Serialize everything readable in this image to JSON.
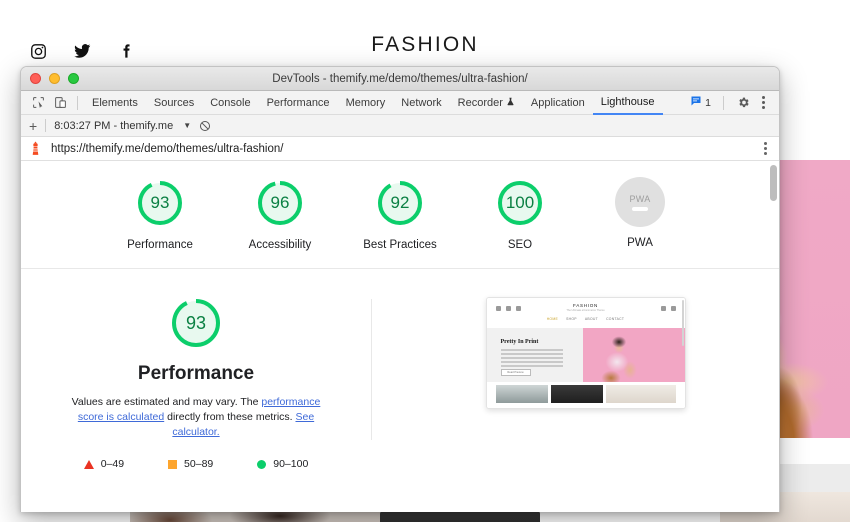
{
  "background_site": {
    "brand": "FASHION",
    "social_icons": [
      "instagram-icon",
      "twitter-icon",
      "facebook-icon"
    ]
  },
  "window": {
    "title": "DevTools - themify.me/demo/themes/ultra-fashion/",
    "traffic_lights": [
      "close",
      "minimize",
      "zoom"
    ]
  },
  "devtools": {
    "left_icons": [
      "inspect-element-icon",
      "device-toolbar-icon"
    ],
    "tabs": [
      {
        "label": "Elements",
        "active": false
      },
      {
        "label": "Sources",
        "active": false
      },
      {
        "label": "Console",
        "active": false
      },
      {
        "label": "Performance",
        "active": false
      },
      {
        "label": "Memory",
        "active": false
      },
      {
        "label": "Network",
        "active": false
      },
      {
        "label": "Recorder",
        "active": false,
        "icon": "experiment-flask-icon"
      },
      {
        "label": "Application",
        "active": false
      },
      {
        "label": "Lighthouse",
        "active": true
      }
    ],
    "message_count": "1",
    "right_icons": [
      "messages-icon",
      "settings-gear-icon",
      "more-options-kebab-icon"
    ],
    "action_bar": {
      "add_label": "+",
      "run_label": "8:03:27 PM - themify.me",
      "clear_icon": "clear-circle-slash-icon"
    },
    "url_bar": {
      "icon": "lighthouse-icon",
      "url": "https://themify.me/demo/themes/ultra-fashion/",
      "menu_icon": "more-options-kebab-icon"
    }
  },
  "report": {
    "scores": [
      {
        "label": "Performance",
        "value": "93",
        "pct": 93,
        "type": "gauge"
      },
      {
        "label": "Accessibility",
        "value": "96",
        "pct": 96,
        "type": "gauge"
      },
      {
        "label": "Best Practices",
        "value": "92",
        "pct": 92,
        "type": "gauge"
      },
      {
        "label": "SEO",
        "value": "100",
        "pct": 100,
        "type": "gauge"
      },
      {
        "label": "PWA",
        "value": "PWA",
        "pct": 0,
        "type": "pwa"
      }
    ],
    "performance": {
      "score": "93",
      "pct": 93,
      "title": "Performance",
      "desc_1": "Values are estimated and may vary. The ",
      "link_1": "performance score is calculated",
      "desc_2": " directly from these metrics. ",
      "link_2": "See calculator.",
      "legend": [
        {
          "shape": "triangle",
          "label": "0–49",
          "color": "#ea3323"
        },
        {
          "shape": "square",
          "label": "50–89",
          "color": "#fda52e"
        },
        {
          "shape": "circle",
          "label": "90–100",
          "color": "#0cce6b"
        }
      ]
    },
    "thumbnail": {
      "brand": "FASHION",
      "tagline": "The Ultimate eCommerce Theme",
      "nav": [
        "HOME",
        "SHOP",
        "ABOUT",
        "CONTACT"
      ],
      "hero_title": "Pretty In Print",
      "hero_button": "Read Preview"
    }
  },
  "colors": {
    "green": "#0cce6b",
    "green_text": "#0b8043",
    "orange": "#fda52e",
    "red": "#ea3323",
    "accent_blue": "#4285f4",
    "link_blue": "#3f6ad8",
    "pink": "#f0a9c6"
  }
}
